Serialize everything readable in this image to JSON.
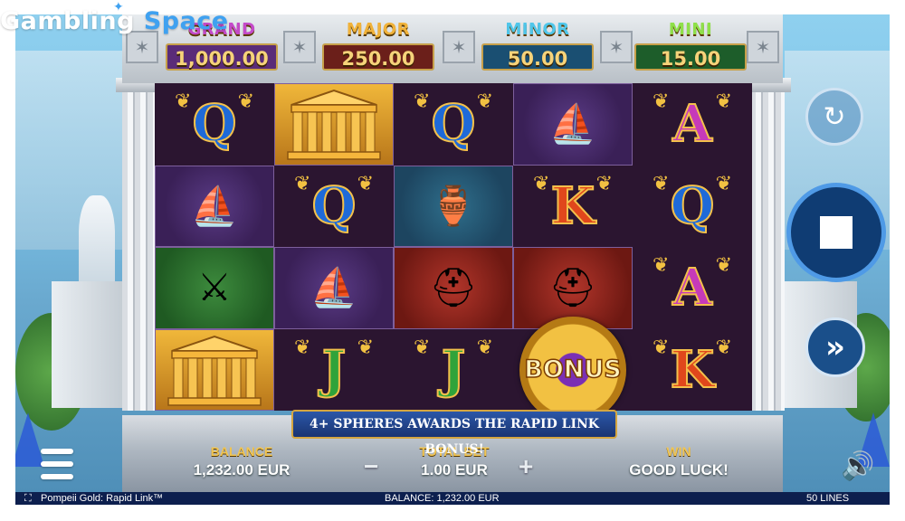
{
  "watermark": {
    "part1": "Gambling",
    "part2": "Space"
  },
  "jackpots": [
    {
      "label": "GRAND",
      "value": "1,000.00",
      "label_color": "#c44ac9",
      "box_color": "#5a2c78"
    },
    {
      "label": "MAJOR",
      "value": "250.00",
      "label_color": "#f0b23a",
      "box_color": "#6b1f1a"
    },
    {
      "label": "MINOR",
      "value": "50.00",
      "label_color": "#4fc6ea",
      "box_color": "#1a4f72"
    },
    {
      "label": "MINI",
      "value": "15.00",
      "label_color": "#8fe04a",
      "box_color": "#1d5d2a"
    }
  ],
  "reels": [
    [
      "Q",
      "ship",
      "crossed-swords",
      "temple"
    ],
    [
      "temple",
      "Q",
      "ship",
      "J"
    ],
    [
      "Q",
      "amphora",
      "helmet",
      "J"
    ],
    [
      "ship",
      "K",
      "helmet",
      "BONUS"
    ],
    [
      "A",
      "Q",
      "A",
      "K"
    ]
  ],
  "bonus_symbol_text": "BONUS",
  "banner": "4+ SPHERES AWARDS THE RAPID LINK BONUS!",
  "panel": {
    "balance_label": "BALANCE",
    "balance_value": "1,232.00 EUR",
    "total_bet_label": "TOTAL BET",
    "total_bet_value": "1.00 EUR",
    "minus": "−",
    "plus": "+",
    "win_label": "WIN",
    "win_value": "GOOD LUCK!"
  },
  "controls": {
    "autoplay_icon": "autoplay-icon",
    "spin_icon": "stop-icon",
    "turbo_icon": "fast-forward-icon",
    "turbo_glyph": "»",
    "menu_icon": "hamburger-menu-icon",
    "sound_icon": "speaker-icon",
    "sound_glyph": "🔊"
  },
  "status_bar": {
    "game_title": "Pompeii Gold: Rapid Link™",
    "balance": "BALANCE: 1,232.00 EUR",
    "lines": "50 LINES"
  },
  "colors": {
    "spin_ring": "#4f9ae6",
    "status_bar_bg": "#0d1f4e",
    "panel_gold": "#f1c552"
  }
}
